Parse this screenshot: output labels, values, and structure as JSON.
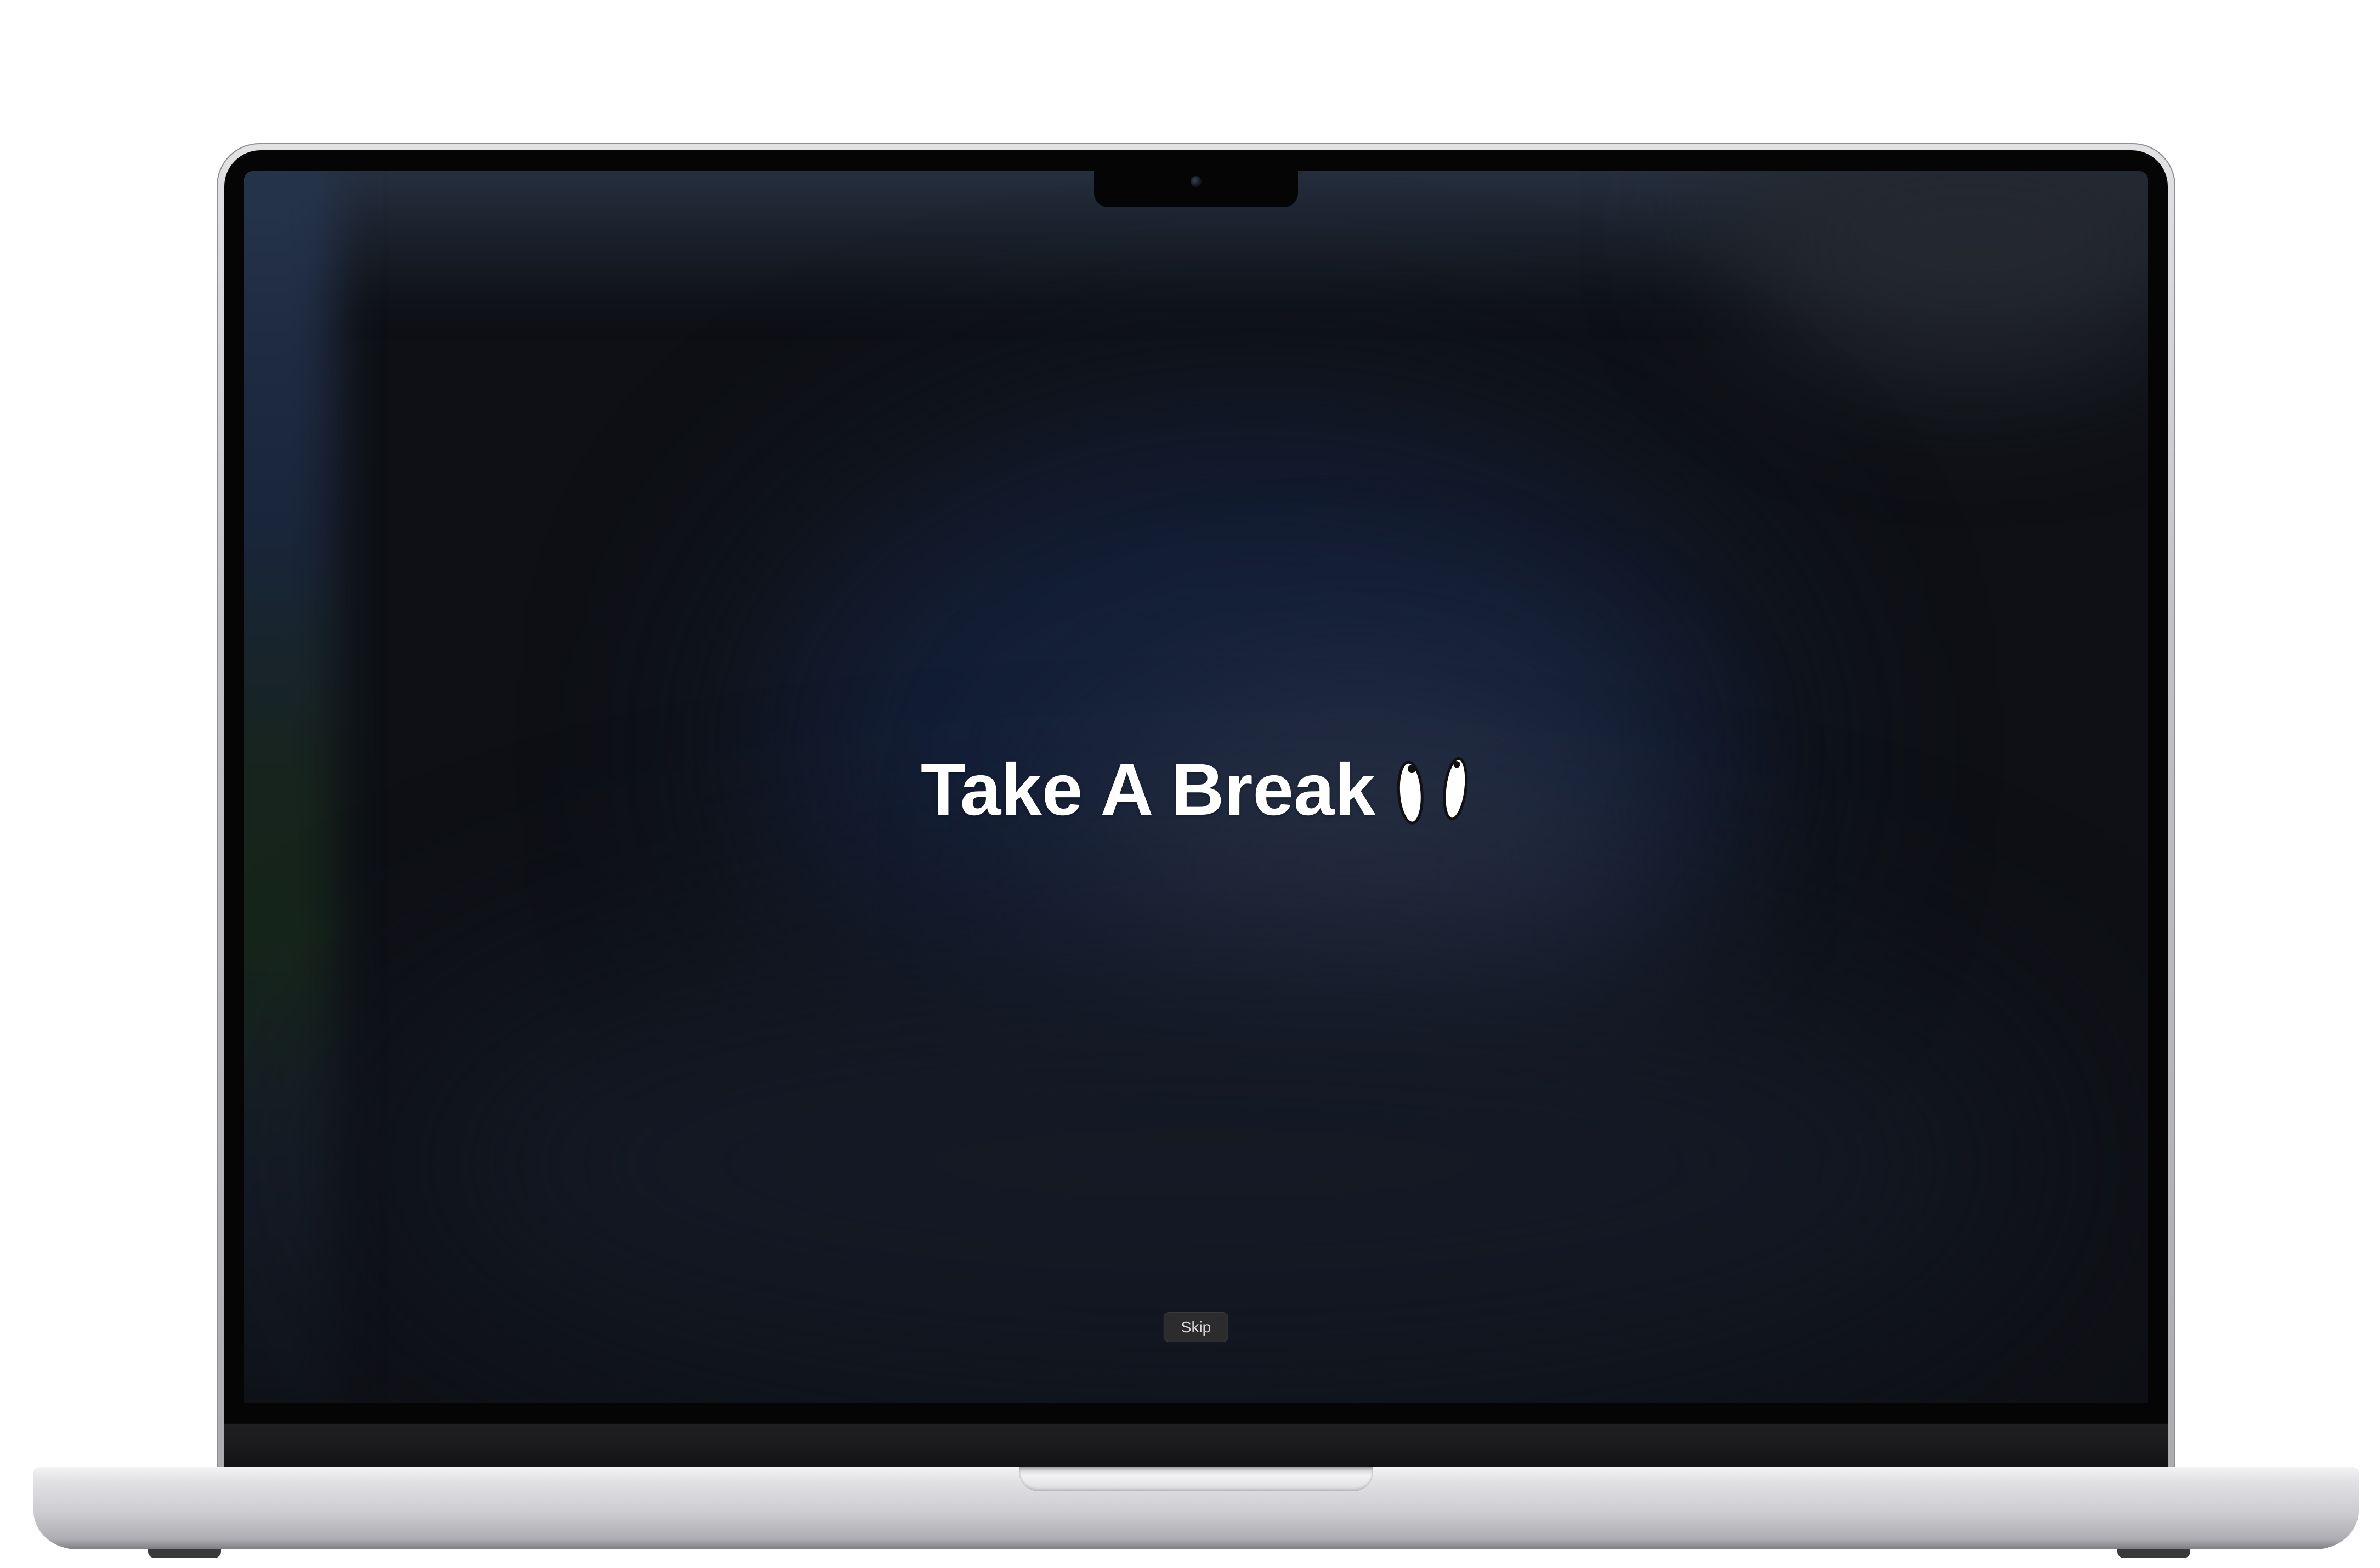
{
  "screen": {
    "title": "Take A Break",
    "title_icon": "footprints-icon",
    "skip_label": "Skip"
  },
  "device": {
    "camera_icon": "camera-icon"
  },
  "colors": {
    "page_background": "#ffffff",
    "screen_background": "#0e1015",
    "title_text": "#ffffff",
    "skip_button_background": "#2c2c2e",
    "skip_button_text": "#d9d9d9"
  }
}
